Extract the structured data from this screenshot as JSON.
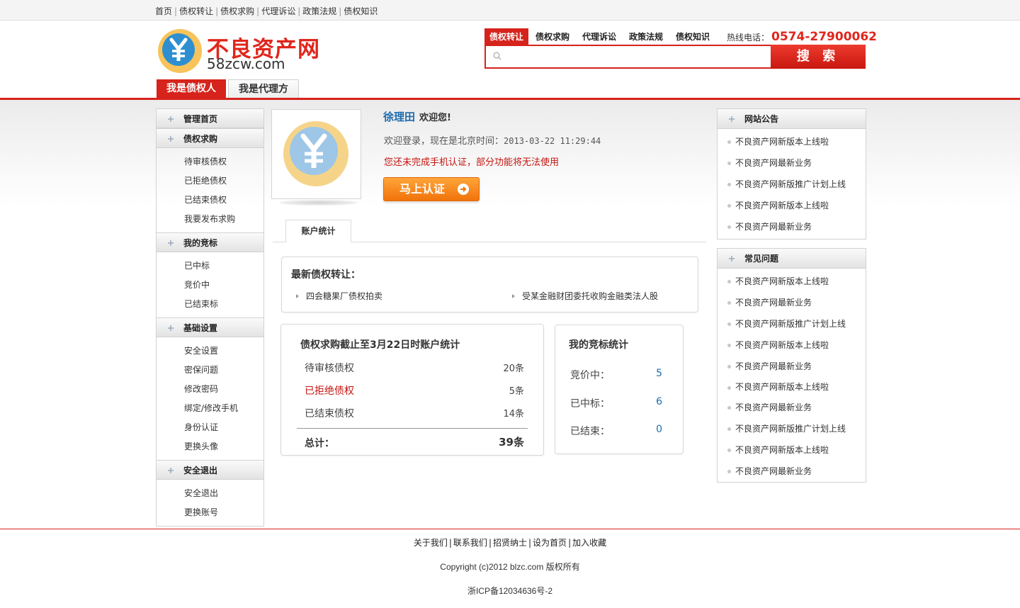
{
  "topnav": [
    "首页",
    "债权转让",
    "债权求购",
    "代理诉讼",
    "政策法规",
    "债权知识"
  ],
  "logo": {
    "title": "不良资产网",
    "domain": "58zcw.com"
  },
  "search": {
    "tabs": [
      "债权转让",
      "债权求购",
      "代理诉讼",
      "政策法规",
      "债权知识"
    ],
    "hotline_label": "热线电话：",
    "hotline_number": "0574-27900062",
    "placeholder": "",
    "button": "搜 索"
  },
  "role_tabs": [
    "我是债权人",
    "我是代理方"
  ],
  "sidebar": {
    "groups": [
      {
        "title": "管理首页",
        "items": []
      },
      {
        "title": "债权求购",
        "items": [
          "待审核债权",
          "已拒绝债权",
          "已结束债权",
          "我要发布求购"
        ]
      },
      {
        "title": "我的竞标",
        "items": [
          "已中标",
          "竞价中",
          "已结束标"
        ]
      },
      {
        "title": "基础设置",
        "items": [
          "安全设置",
          "密保问题",
          "修改密码",
          "绑定/修改手机",
          "身份认证",
          "更换头像"
        ]
      },
      {
        "title": "安全退出",
        "items": [
          "安全退出",
          "更换账号"
        ]
      }
    ]
  },
  "user": {
    "name": "徐理田",
    "welcome": "欢迎您!",
    "login_prefix": "欢迎登录，现在是北京时间：",
    "login_time": "2013-03-22 11:29:44",
    "warning": "您还未完成手机认证，部分功能将无法使用",
    "verify_button": "马上认证"
  },
  "account_tab": "账户统计",
  "latest": {
    "title": "最新债权转让：",
    "items": [
      "四会糖果厂债权拍卖",
      "受某金融财团委托收购金融类法人股"
    ]
  },
  "stats": {
    "title": "债权求购截止至3月22日时账户统计",
    "rows": [
      {
        "label": "待审核债权",
        "value": "20条"
      },
      {
        "label": "已拒绝债权",
        "value": "5条"
      },
      {
        "label": "已结束债权",
        "value": "14条"
      }
    ],
    "total_label": "总计：",
    "total_value": "39条"
  },
  "bids": {
    "title": "我的竞标统计",
    "rows": [
      {
        "label": "竞价中：",
        "value": "5"
      },
      {
        "label": "已中标：",
        "value": "6"
      },
      {
        "label": "已结束：",
        "value": "0"
      }
    ]
  },
  "notices": {
    "title": "网站公告",
    "items": [
      "不良资产网新版本上线啦",
      "不良资产网最新业务",
      "不良资产网新版推广计划上线",
      "不良资产网新版本上线啦",
      "不良资产网最新业务"
    ]
  },
  "faq": {
    "title": "常见问题",
    "items": [
      "不良资产网新版本上线啦",
      "不良资产网最新业务",
      "不良资产网新版推广计划上线",
      "不良资产网新版本上线啦",
      "不良资产网最新业务",
      "不良资产网新版本上线啦",
      "不良资产网最新业务",
      "不良资产网新版推广计划上线",
      "不良资产网新版本上线啦",
      "不良资产网最新业务"
    ]
  },
  "footer": {
    "links": [
      "关于我们",
      "联系我们",
      "招贤纳士",
      "设为首页",
      "加入收藏"
    ],
    "copyright": "Copyright (c)2012 blzc.com 版权所有",
    "icp": "浙ICP备12034636号-2"
  },
  "colors": {
    "brand_red": "#d6231b",
    "link_blue": "#1d6bad",
    "warning_red": "#c4140f",
    "button_orange": "#f0730a"
  }
}
